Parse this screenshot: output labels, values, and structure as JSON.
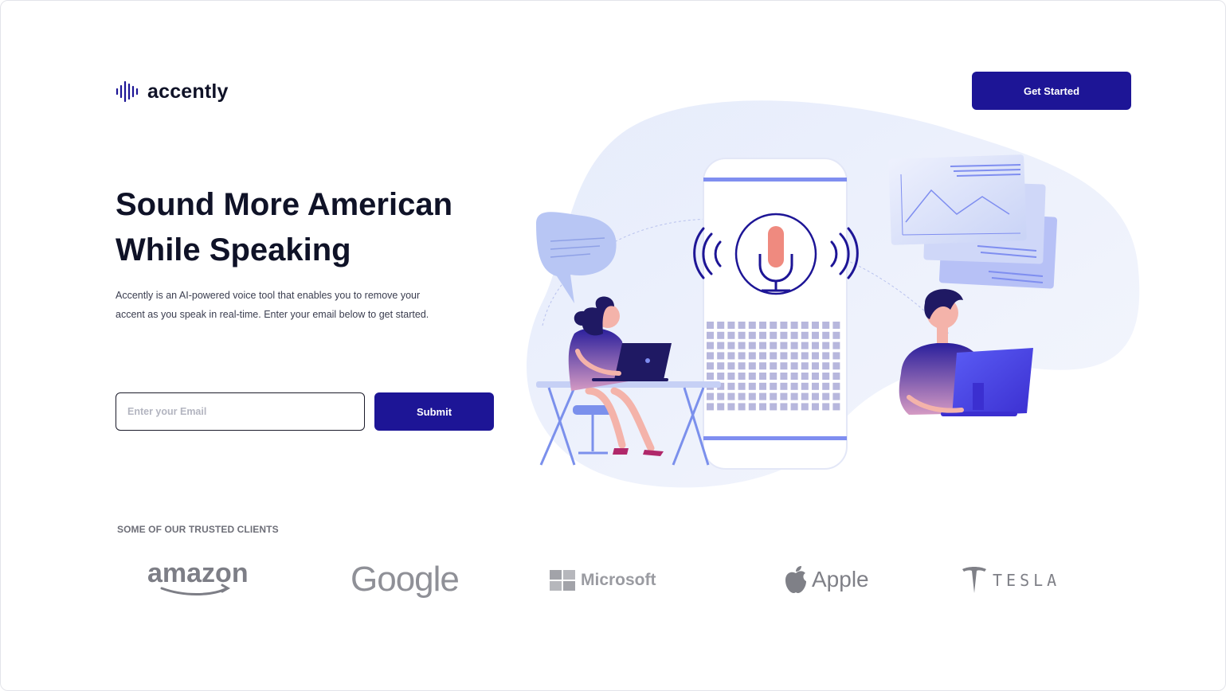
{
  "brand": {
    "name": "accently",
    "accent": "#1d1596"
  },
  "header": {
    "cta_label": "Get Started"
  },
  "hero": {
    "headline_line1": "Sound More American",
    "headline_line2": "While Speaking",
    "description": "Accently is an AI-powered voice tool that enables you to remove your accent as you speak in real-time. Enter your email below to get started.",
    "email_placeholder": "Enter your Email",
    "submit_label": "Submit"
  },
  "clients": {
    "title": "SOME OF OUR TRUSTED CLIENTS",
    "logos": [
      {
        "name": "amazon",
        "icon": "amazon-smile-icon"
      },
      {
        "name": "Google",
        "icon": ""
      },
      {
        "name": "Microsoft",
        "icon": "windows-grid-icon"
      },
      {
        "name": "Apple",
        "icon": "apple-icon"
      },
      {
        "name": "TESLA",
        "icon": "tesla-t-icon"
      }
    ]
  }
}
